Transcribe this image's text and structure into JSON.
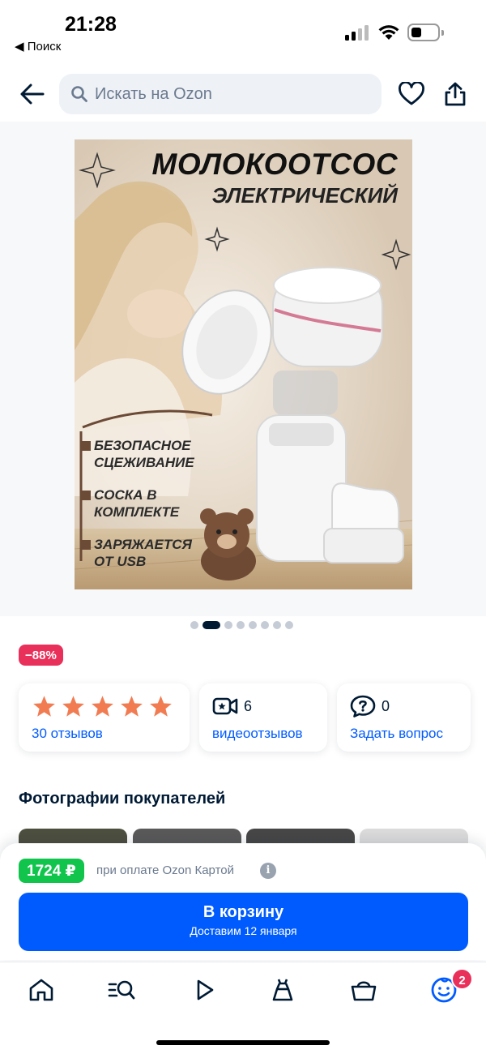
{
  "status_bar": {
    "time": "21:28",
    "back_app": "◀ Поиск"
  },
  "header": {
    "search_placeholder": "Искать на Ozon"
  },
  "product_image": {
    "title": "МОЛОКООТСОС",
    "subtitle": "ЭЛЕКТРИЧЕСКИЙ",
    "features": [
      "БЕЗОПАСНОЕ\nСЦЕЖИВАНИЕ",
      "СОСКА В\nКОМПЛЕКТЕ",
      "ЗАРЯЖАЕТСЯ\nОТ USB"
    ]
  },
  "gallery": {
    "total": 8,
    "active_index": 1
  },
  "discount": "−88%",
  "stats": {
    "rating_stars": 5,
    "reviews_link": "30 отзывов",
    "video_count": "6",
    "video_link": "видеоотзывов",
    "questions_count": "0",
    "questions_link": "Задать вопрос"
  },
  "buyer_photos": {
    "title": "Фотографии покупателей"
  },
  "purchase": {
    "price": "1724 ₽",
    "price_note": "при оплате Ozon Картой",
    "info_icon": "i",
    "cart_label": "В корзину",
    "delivery": "Доставим 12 января"
  },
  "tabbar": {
    "items": [
      "home-icon",
      "catalog-search-icon",
      "fresh-play-icon",
      "fashion-dress-icon",
      "cart-basket-icon",
      "profile-face-icon"
    ],
    "profile_badge": "2"
  },
  "colors": {
    "accent_blue": "#005bff",
    "price_green": "#10c44c",
    "discount_red": "#e8305a",
    "text_dark": "#001a34",
    "star_orange": "#f27c52"
  }
}
